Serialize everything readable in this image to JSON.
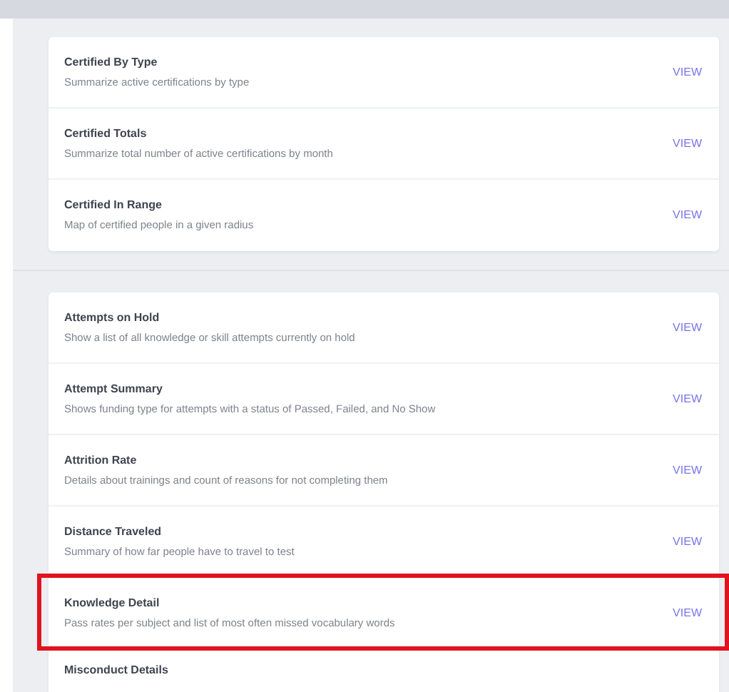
{
  "sections": [
    {
      "reports": [
        {
          "title": "Certified By Type",
          "description": "Summarize active certifications by type",
          "action": "VIEW",
          "highlighted": false
        },
        {
          "title": "Certified Totals",
          "description": "Summarize total number of active certifications by month",
          "action": "VIEW",
          "highlighted": false
        },
        {
          "title": "Certified In Range",
          "description": "Map of certified people in a given radius",
          "action": "VIEW",
          "highlighted": false
        }
      ]
    },
    {
      "reports": [
        {
          "title": "Attempts on Hold",
          "description": "Show a list of all knowledge or skill attempts currently on hold",
          "action": "VIEW",
          "highlighted": false
        },
        {
          "title": "Attempt Summary",
          "description": "Shows funding type for attempts with a status of Passed, Failed, and No Show",
          "action": "VIEW",
          "highlighted": false
        },
        {
          "title": "Attrition Rate",
          "description": "Details about trainings and count of reasons for not completing them",
          "action": "VIEW",
          "highlighted": false
        },
        {
          "title": "Distance Traveled",
          "description": "Summary of how far people have to travel to test",
          "action": "VIEW",
          "highlighted": false
        },
        {
          "title": "Knowledge Detail",
          "description": "Pass rates per subject and list of most often missed vocabulary words",
          "action": "VIEW",
          "highlighted": true
        },
        {
          "title": "Misconduct Details",
          "highlighted": false
        }
      ]
    }
  ]
}
